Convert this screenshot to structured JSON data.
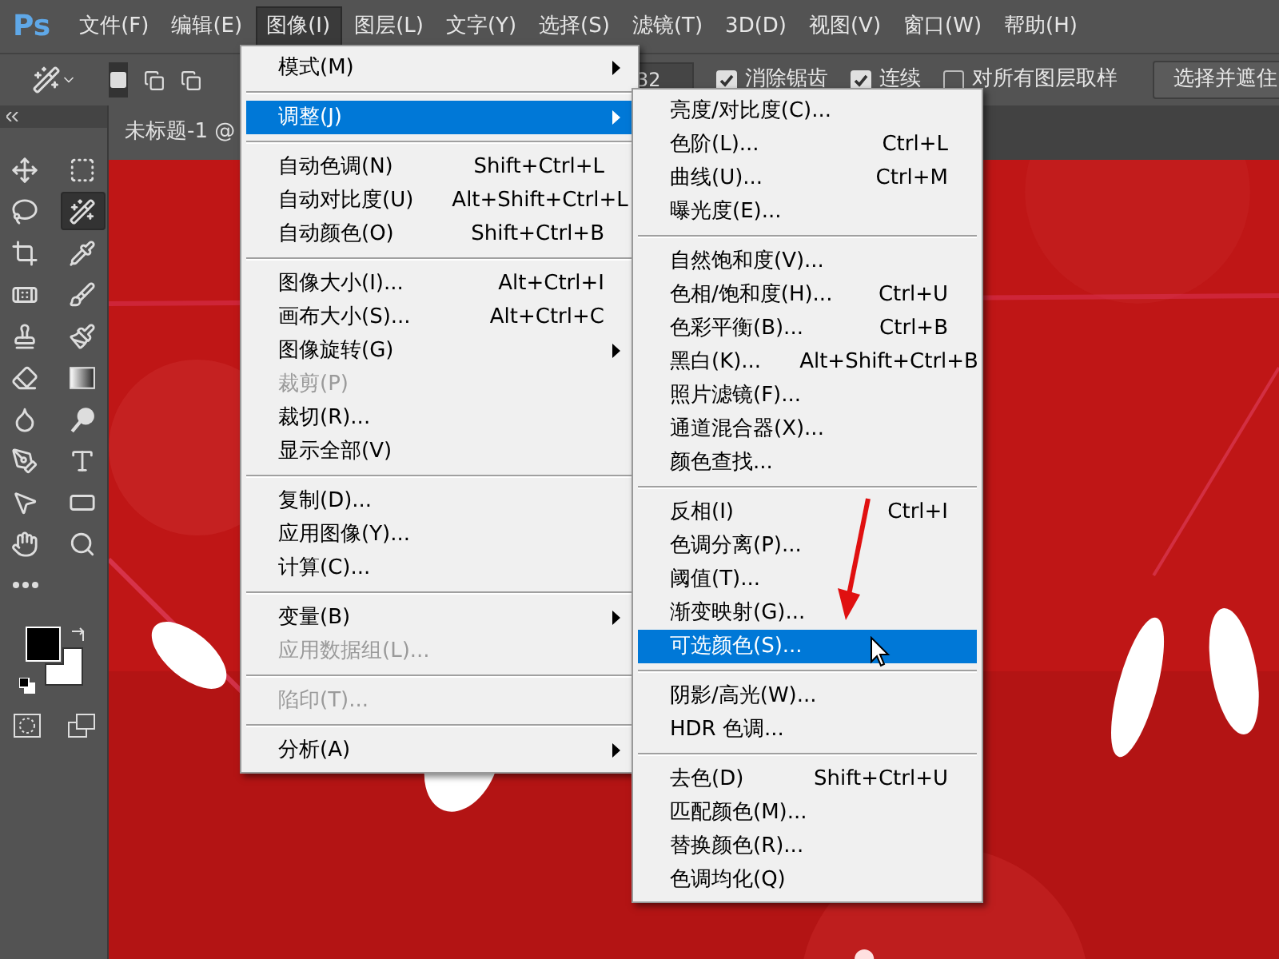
{
  "app": {
    "logo": "Ps"
  },
  "menu_bar": [
    {
      "label": "文件(F)",
      "selected": false
    },
    {
      "label": "编辑(E)",
      "selected": false
    },
    {
      "label": "图像(I)",
      "selected": true
    },
    {
      "label": "图层(L)",
      "selected": false
    },
    {
      "label": "文字(Y)",
      "selected": false
    },
    {
      "label": "选择(S)",
      "selected": false
    },
    {
      "label": "滤镜(T)",
      "selected": false
    },
    {
      "label": "3D(D)",
      "selected": false
    },
    {
      "label": "视图(V)",
      "selected": false
    },
    {
      "label": "窗口(W)",
      "selected": false
    },
    {
      "label": "帮助(H)",
      "selected": false
    }
  ],
  "options_bar": {
    "selection_modes": [
      {
        "selected": true
      },
      {
        "selected": false
      },
      {
        "selected": false
      }
    ],
    "tolerance": "32",
    "checkboxes": [
      {
        "label": "消除锯齿",
        "checked": true
      },
      {
        "label": "连续",
        "checked": true
      },
      {
        "label": "对所有图层取样",
        "checked": false
      }
    ],
    "button": "选择并遮住"
  },
  "toolbar": {
    "tools": [
      {
        "selected": false
      },
      {
        "selected": false
      },
      {
        "selected": false
      },
      {
        "selected": true
      },
      {
        "selected": false
      },
      {
        "selected": false
      },
      {
        "selected": false
      },
      {
        "selected": false
      },
      {
        "selected": false
      },
      {
        "selected": false
      },
      {
        "selected": false
      },
      {
        "selected": false
      },
      {
        "selected": false
      },
      {
        "selected": false
      },
      {
        "selected": false
      },
      {
        "selected": false
      },
      {
        "selected": false
      },
      {
        "selected": false
      },
      {
        "selected": false
      },
      {
        "selected": false
      },
      {
        "selected": false
      }
    ]
  },
  "document_tab": {
    "title": "未标题-1 @"
  },
  "image_menu": {
    "groups": [
      {
        "items": [
          {
            "label": "模式(M)",
            "submenu": true,
            "disabled": false,
            "selected": false
          }
        ]
      },
      {
        "items": [
          {
            "label": "调整(J)",
            "submenu": true,
            "disabled": false,
            "selected": true
          }
        ]
      },
      {
        "items": [
          {
            "label": "自动色调(N)",
            "shortcut": "Shift+Ctrl+L",
            "submenu": false,
            "disabled": false,
            "selected": false
          },
          {
            "label": "自动对比度(U)",
            "shortcut": "Alt+Shift+Ctrl+L",
            "submenu": false,
            "disabled": false,
            "selected": false
          },
          {
            "label": "自动颜色(O)",
            "shortcut": "Shift+Ctrl+B",
            "submenu": false,
            "disabled": false,
            "selected": false
          }
        ]
      },
      {
        "items": [
          {
            "label": "图像大小(I)...",
            "shortcut": "Alt+Ctrl+I",
            "submenu": false,
            "disabled": false,
            "selected": false
          },
          {
            "label": "画布大小(S)...",
            "shortcut": "Alt+Ctrl+C",
            "submenu": false,
            "disabled": false,
            "selected": false
          },
          {
            "label": "图像旋转(G)",
            "submenu": true,
            "disabled": false,
            "selected": false
          },
          {
            "label": "裁剪(P)",
            "submenu": false,
            "disabled": true,
            "selected": false
          },
          {
            "label": "裁切(R)...",
            "submenu": false,
            "disabled": false,
            "selected": false
          },
          {
            "label": "显示全部(V)",
            "submenu": false,
            "disabled": false,
            "selected": false
          }
        ]
      },
      {
        "items": [
          {
            "label": "复制(D)...",
            "submenu": false,
            "disabled": false,
            "selected": false
          },
          {
            "label": "应用图像(Y)...",
            "submenu": false,
            "disabled": false,
            "selected": false
          },
          {
            "label": "计算(C)...",
            "submenu": false,
            "disabled": false,
            "selected": false
          }
        ]
      },
      {
        "items": [
          {
            "label": "变量(B)",
            "submenu": true,
            "disabled": false,
            "selected": false
          },
          {
            "label": "应用数据组(L)...",
            "submenu": false,
            "disabled": true,
            "selected": false
          }
        ]
      },
      {
        "items": [
          {
            "label": "陷印(T)...",
            "submenu": false,
            "disabled": true,
            "selected": false
          }
        ]
      },
      {
        "items": [
          {
            "label": "分析(A)",
            "submenu": true,
            "disabled": false,
            "selected": false
          }
        ]
      }
    ]
  },
  "adjustments_menu": {
    "groups": [
      {
        "items": [
          {
            "label": "亮度/对比度(C)...",
            "selected": false
          },
          {
            "label": "色阶(L)...",
            "shortcut": "Ctrl+L",
            "selected": false
          },
          {
            "label": "曲线(U)...",
            "shortcut": "Ctrl+M",
            "selected": false
          },
          {
            "label": "曝光度(E)...",
            "selected": false
          }
        ]
      },
      {
        "items": [
          {
            "label": "自然饱和度(V)...",
            "selected": false
          },
          {
            "label": "色相/饱和度(H)...",
            "shortcut": "Ctrl+U",
            "selected": false
          },
          {
            "label": "色彩平衡(B)...",
            "shortcut": "Ctrl+B",
            "selected": false
          },
          {
            "label": "黑白(K)...",
            "shortcut": "Alt+Shift+Ctrl+B",
            "selected": false
          },
          {
            "label": "照片滤镜(F)...",
            "selected": false
          },
          {
            "label": "通道混合器(X)...",
            "selected": false
          },
          {
            "label": "颜色查找...",
            "selected": false
          }
        ]
      },
      {
        "items": [
          {
            "label": "反相(I)",
            "shortcut": "Ctrl+I",
            "selected": false
          },
          {
            "label": "色调分离(P)...",
            "selected": false
          },
          {
            "label": "阈值(T)...",
            "selected": false
          },
          {
            "label": "渐变映射(G)...",
            "selected": false
          },
          {
            "label": "可选颜色(S)...",
            "selected": true
          }
        ]
      },
      {
        "items": [
          {
            "label": "阴影/高光(W)...",
            "selected": false
          },
          {
            "label": "HDR 色调...",
            "selected": false
          }
        ]
      },
      {
        "items": [
          {
            "label": "去色(D)",
            "shortcut": "Shift+Ctrl+U",
            "selected": false
          },
          {
            "label": "匹配颜色(M)...",
            "selected": false
          },
          {
            "label": "替换颜色(R)...",
            "selected": false
          },
          {
            "label": "色调均化(Q)",
            "selected": false
          }
        ]
      }
    ]
  }
}
